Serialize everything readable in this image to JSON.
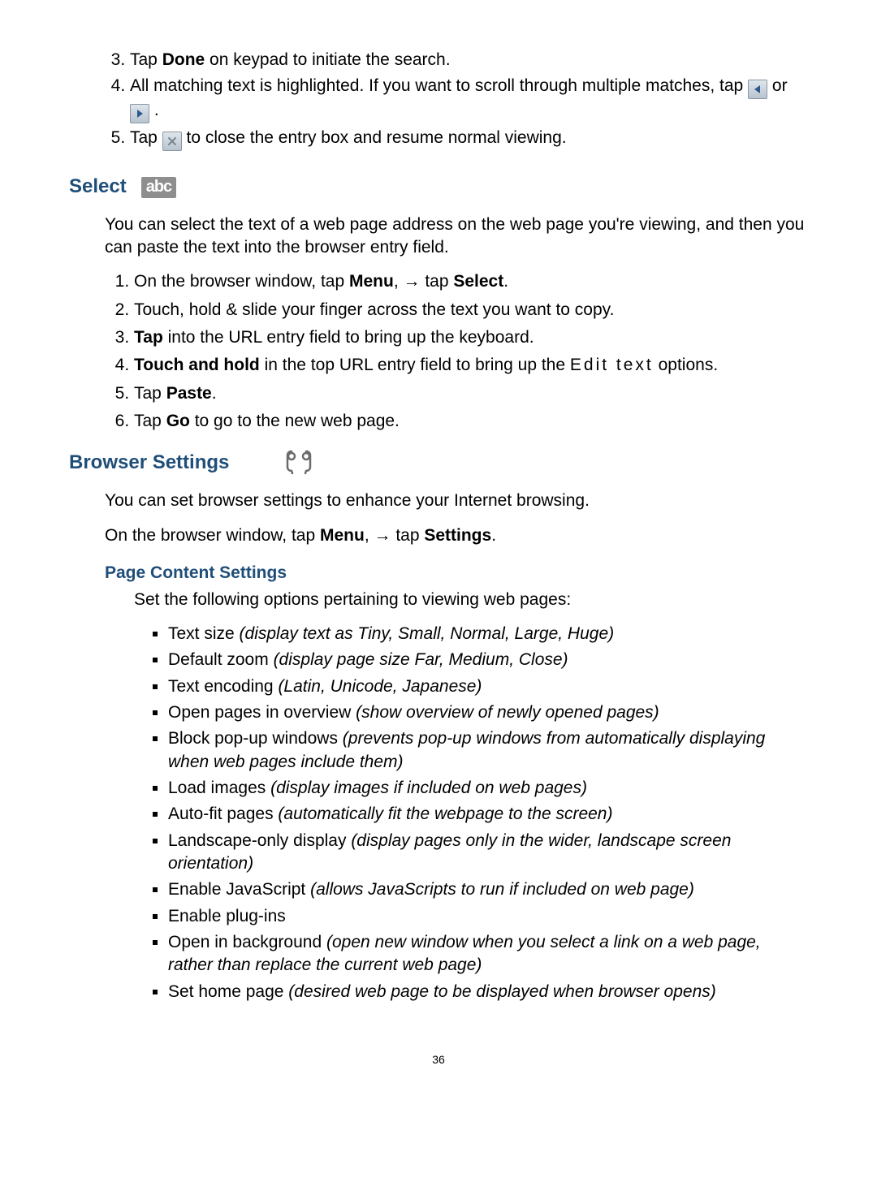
{
  "steps_top": {
    "start": 3,
    "items": [
      {
        "pre": "Tap ",
        "bold": "Done",
        "post": " on keypad to initiate the search."
      },
      {
        "pre": "All matching text is highlighted. If you want to scroll through multiple matches, tap ",
        "mid": " or ",
        "post": "."
      },
      {
        "pre": "Tap ",
        "post": " to close the entry box and resume normal viewing."
      }
    ]
  },
  "select": {
    "heading": "Select",
    "badge": "abc",
    "intro": "You can select the text of a web page address on the web page you're viewing, and then you can paste the text into the browser entry field.",
    "steps": [
      {
        "t1": "On the browser window, tap ",
        "b1": "Menu",
        "t2": ", → tap ",
        "b2": "Select",
        "t3": "."
      },
      {
        "t1": "Touch, hold & slide your finger across the text you want to copy."
      },
      {
        "b1": "Tap",
        "t2": " into the URL entry field to bring up the keyboard."
      },
      {
        "b1": "Touch and hold",
        "t2": " in the top URL entry field to bring up the ",
        "code": "Edit text",
        "t3": " options."
      },
      {
        "t1": "Tap ",
        "b1": "Paste",
        "t2": "."
      },
      {
        "t1": "Tap ",
        "b1": "Go",
        "t2": " to go to the new web page."
      }
    ]
  },
  "browser": {
    "heading": "Browser Settings",
    "intro": "You can set browser settings to enhance your Internet browsing.",
    "line2_a": "On the browser window, tap ",
    "line2_b1": "Menu",
    "line2_mid": ", → tap ",
    "line2_b2": "Settings",
    "line2_end": ".",
    "pcs_heading": "Page Content Settings",
    "pcs_intro": "Set the following options pertaining to viewing web pages:",
    "bullets": [
      {
        "label": "Text size ",
        "desc": "(display text as Tiny, Small, Normal, Large, Huge)"
      },
      {
        "label": "Default zoom ",
        "desc": "(display page size Far, Medium, Close)"
      },
      {
        "label": "Text encoding ",
        "desc": "(Latin, Unicode, Japanese)"
      },
      {
        "label": "Open pages in overview ",
        "desc": "(show overview of newly opened pages)"
      },
      {
        "label": "Block pop-up windows ",
        "desc": "(prevents pop-up windows from automatically displaying when web pages include them)"
      },
      {
        "label": "Load images ",
        "desc": "(display images if included on web pages)"
      },
      {
        "label": "Auto-fit pages ",
        "desc": "(automatically fit the webpage to the screen)"
      },
      {
        "label": "Landscape-only display ",
        "desc": "(display pages only in the wider, landscape screen orientation)"
      },
      {
        "label": "Enable JavaScript ",
        "desc": "(allows JavaScripts to run if included on web page)"
      },
      {
        "label": "Enable plug-ins",
        "desc": ""
      },
      {
        "label": "Open in background ",
        "desc": "(open new window when you select a link on a web page, rather than replace the current web page)"
      },
      {
        "label": "Set home page ",
        "desc": "(desired web page to be displayed when browser opens)"
      }
    ]
  },
  "page_number": "36"
}
